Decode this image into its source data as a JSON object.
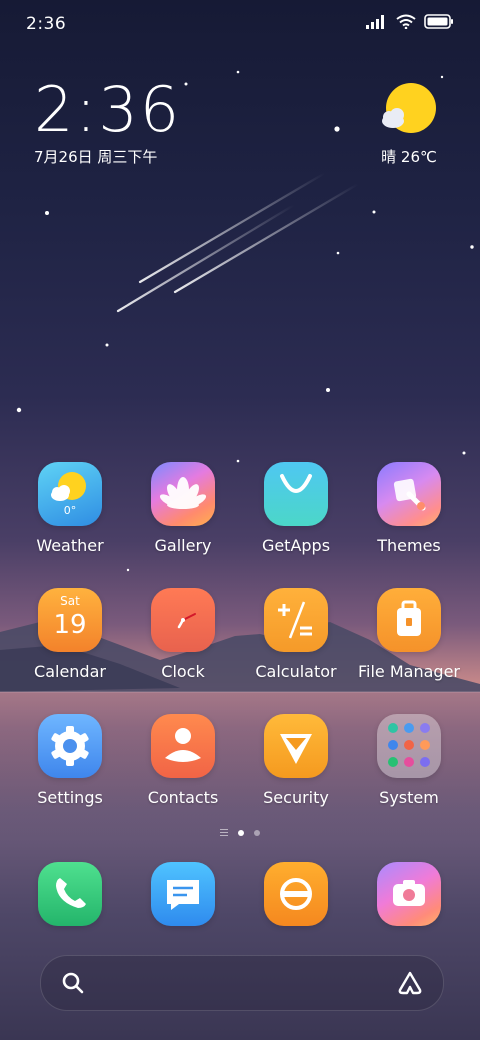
{
  "status_bar": {
    "time": "2:36"
  },
  "clock_widget": {
    "time": "2:36",
    "date": "7月26日 周三下午"
  },
  "weather_widget": {
    "condition_temp": "晴 26℃"
  },
  "apps": {
    "row1": [
      {
        "label": "Weather",
        "icon": "weather-icon",
        "badge": "0°"
      },
      {
        "label": "Gallery",
        "icon": "lotus-icon"
      },
      {
        "label": "GetApps",
        "icon": "bag-icon"
      },
      {
        "label": "Themes",
        "icon": "brush-icon"
      }
    ],
    "row2": [
      {
        "label": "Calendar",
        "icon": "calendar-icon",
        "day": "Sat",
        "date": "19"
      },
      {
        "label": "Clock",
        "icon": "clock-icon"
      },
      {
        "label": "Calculator",
        "icon": "calculator-icon"
      },
      {
        "label": "File Manager",
        "icon": "folder-icon"
      }
    ],
    "row3": [
      {
        "label": "Settings",
        "icon": "gear-icon"
      },
      {
        "label": "Contacts",
        "icon": "person-icon"
      },
      {
        "label": "Security",
        "icon": "shield-icon"
      },
      {
        "label": "System",
        "icon": "folder-grid-icon"
      }
    ]
  },
  "page_indicator": {
    "pages": 2,
    "active": 1
  },
  "dock": [
    "phone-icon",
    "messages-icon",
    "browser-icon",
    "camera-icon"
  ],
  "colors": {
    "accent_yellow": "#ffd21f",
    "night": "#161a35"
  }
}
